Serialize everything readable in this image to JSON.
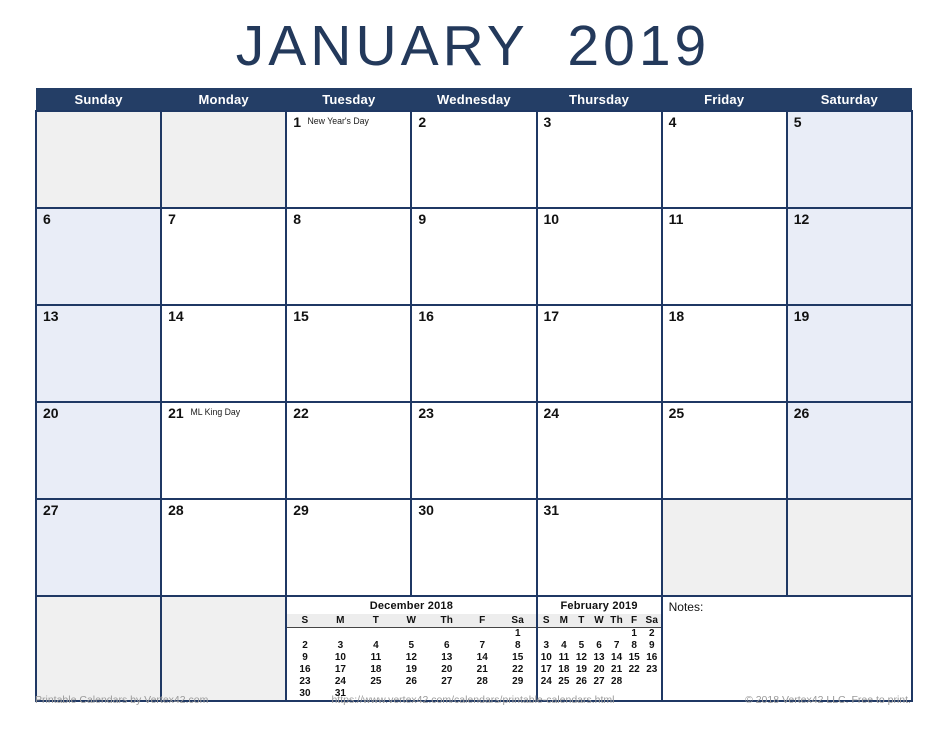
{
  "title": "JANUARY  2019",
  "month_name": "January",
  "year": "2019",
  "weekday_headers": [
    "Sunday",
    "Monday",
    "Tuesday",
    "Wednesday",
    "Thursday",
    "Friday",
    "Saturday"
  ],
  "colors": {
    "header_navy": "#243E66",
    "grid_border": "#1F3864",
    "weekend_tint": "#E9EDF7",
    "filler_gray": "#F0F0F0",
    "title_navy": "#23395b",
    "footer_gray": "#9a9a9a"
  },
  "weeks": [
    [
      {
        "day": "",
        "event": "",
        "type": "filler"
      },
      {
        "day": "",
        "event": "",
        "type": "filler"
      },
      {
        "day": "1",
        "event": "New Year's Day",
        "type": "weekday"
      },
      {
        "day": "2",
        "event": "",
        "type": "weekday"
      },
      {
        "day": "3",
        "event": "",
        "type": "weekday"
      },
      {
        "day": "4",
        "event": "",
        "type": "weekday"
      },
      {
        "day": "5",
        "event": "",
        "type": "weekend"
      }
    ],
    [
      {
        "day": "6",
        "event": "",
        "type": "weekend"
      },
      {
        "day": "7",
        "event": "",
        "type": "weekday"
      },
      {
        "day": "8",
        "event": "",
        "type": "weekday"
      },
      {
        "day": "9",
        "event": "",
        "type": "weekday"
      },
      {
        "day": "10",
        "event": "",
        "type": "weekday"
      },
      {
        "day": "11",
        "event": "",
        "type": "weekday"
      },
      {
        "day": "12",
        "event": "",
        "type": "weekend"
      }
    ],
    [
      {
        "day": "13",
        "event": "",
        "type": "weekend"
      },
      {
        "day": "14",
        "event": "",
        "type": "weekday"
      },
      {
        "day": "15",
        "event": "",
        "type": "weekday"
      },
      {
        "day": "16",
        "event": "",
        "type": "weekday"
      },
      {
        "day": "17",
        "event": "",
        "type": "weekday"
      },
      {
        "day": "18",
        "event": "",
        "type": "weekday"
      },
      {
        "day": "19",
        "event": "",
        "type": "weekend"
      }
    ],
    [
      {
        "day": "20",
        "event": "",
        "type": "weekend"
      },
      {
        "day": "21",
        "event": "ML King Day",
        "type": "weekday"
      },
      {
        "day": "22",
        "event": "",
        "type": "weekday"
      },
      {
        "day": "23",
        "event": "",
        "type": "weekday"
      },
      {
        "day": "24",
        "event": "",
        "type": "weekday"
      },
      {
        "day": "25",
        "event": "",
        "type": "weekday"
      },
      {
        "day": "26",
        "event": "",
        "type": "weekend"
      }
    ],
    [
      {
        "day": "27",
        "event": "",
        "type": "weekend"
      },
      {
        "day": "28",
        "event": "",
        "type": "weekday"
      },
      {
        "day": "29",
        "event": "",
        "type": "weekday"
      },
      {
        "day": "30",
        "event": "",
        "type": "weekday"
      },
      {
        "day": "31",
        "event": "",
        "type": "weekday"
      },
      {
        "day": "",
        "event": "",
        "type": "filler"
      },
      {
        "day": "",
        "event": "",
        "type": "filler"
      }
    ]
  ],
  "mini_calendars": {
    "previous": {
      "title": "December 2018",
      "headers": [
        "S",
        "M",
        "T",
        "W",
        "Th",
        "F",
        "Sa"
      ],
      "weeks": [
        [
          "",
          "",
          "",
          "",
          "",
          "",
          "1"
        ],
        [
          "2",
          "3",
          "4",
          "5",
          "6",
          "7",
          "8"
        ],
        [
          "9",
          "10",
          "11",
          "12",
          "13",
          "14",
          "15"
        ],
        [
          "16",
          "17",
          "18",
          "19",
          "20",
          "21",
          "22"
        ],
        [
          "23",
          "24",
          "25",
          "26",
          "27",
          "28",
          "29"
        ],
        [
          "30",
          "31",
          "",
          "",
          "",
          "",
          ""
        ]
      ]
    },
    "next": {
      "title": "February 2019",
      "headers": [
        "S",
        "M",
        "T",
        "W",
        "Th",
        "F",
        "Sa"
      ],
      "weeks": [
        [
          "",
          "",
          "",
          "",
          "",
          "1",
          "2"
        ],
        [
          "3",
          "4",
          "5",
          "6",
          "7",
          "8",
          "9"
        ],
        [
          "10",
          "11",
          "12",
          "13",
          "14",
          "15",
          "16"
        ],
        [
          "17",
          "18",
          "19",
          "20",
          "21",
          "22",
          "23"
        ],
        [
          "24",
          "25",
          "26",
          "27",
          "28",
          "",
          ""
        ]
      ]
    }
  },
  "notes": {
    "label": "Notes:",
    "value": ""
  },
  "footer": {
    "left": "Printable Calendars by Vertex42.com",
    "center": "https://www.vertex42.com/calendars/printable-calendars.html",
    "right": "© 2018 Vertex42 LLC. Free to print."
  }
}
